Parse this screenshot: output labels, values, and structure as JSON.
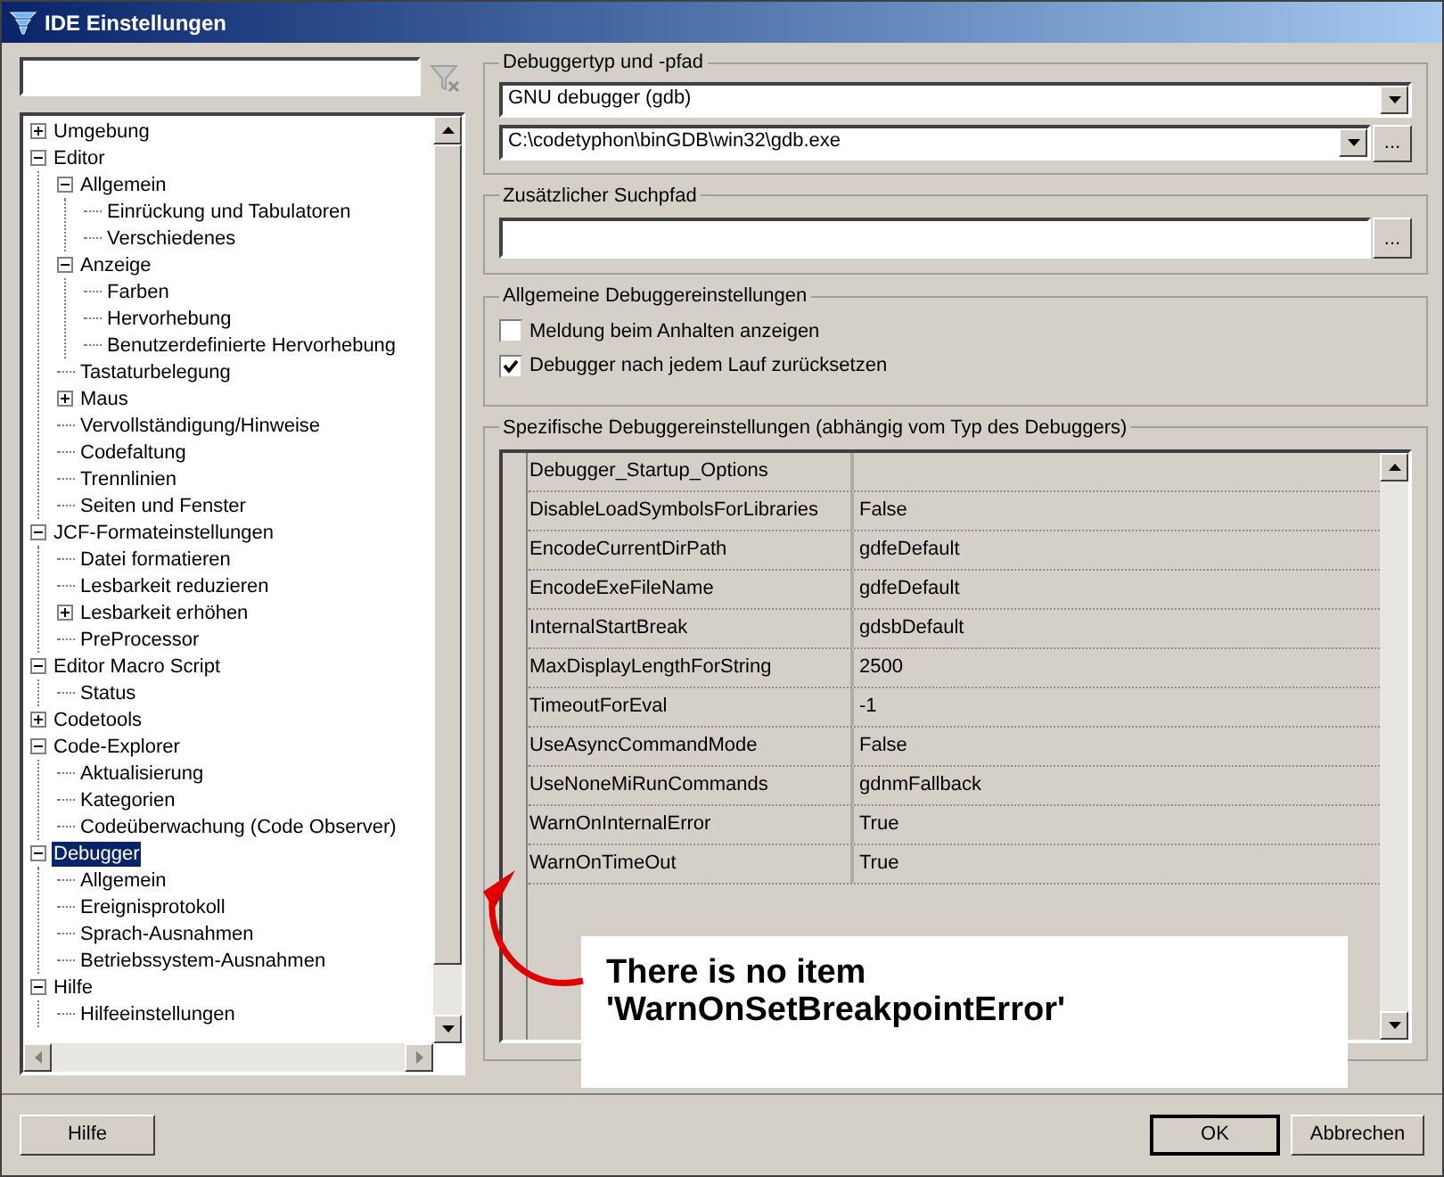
{
  "window": {
    "title": "IDE Einstellungen"
  },
  "tree": [
    {
      "label": "Umgebung",
      "expanded": false,
      "selected": false
    },
    {
      "label": "Editor",
      "expanded": true,
      "selected": false,
      "children": [
        {
          "label": "Allgemein",
          "expanded": true,
          "selected": false,
          "children": [
            {
              "label": "Einrückung und Tabulatoren",
              "selected": false
            },
            {
              "label": "Verschiedenes",
              "selected": false
            }
          ]
        },
        {
          "label": "Anzeige",
          "expanded": true,
          "selected": false,
          "children": [
            {
              "label": "Farben",
              "selected": false
            },
            {
              "label": "Hervorhebung",
              "selected": false
            },
            {
              "label": "Benutzerdefinierte Hervorhebung",
              "selected": false
            }
          ]
        },
        {
          "label": "Tastaturbelegung",
          "selected": false
        },
        {
          "label": "Maus",
          "expanded": false,
          "selected": false
        },
        {
          "label": "Vervollständigung/Hinweise",
          "selected": false
        },
        {
          "label": "Codefaltung",
          "selected": false
        },
        {
          "label": "Trennlinien",
          "selected": false
        },
        {
          "label": "Seiten und Fenster",
          "selected": false
        }
      ]
    },
    {
      "label": "JCF-Formateinstellungen",
      "expanded": true,
      "selected": false,
      "children": [
        {
          "label": "Datei formatieren",
          "selected": false
        },
        {
          "label": "Lesbarkeit reduzieren",
          "selected": false
        },
        {
          "label": "Lesbarkeit erhöhen",
          "expanded": false,
          "selected": false
        },
        {
          "label": "PreProcessor",
          "selected": false
        }
      ]
    },
    {
      "label": "Editor Macro Script",
      "expanded": true,
      "selected": false,
      "children": [
        {
          "label": "Status",
          "selected": false
        }
      ]
    },
    {
      "label": "Codetools",
      "expanded": false,
      "selected": false
    },
    {
      "label": "Code-Explorer",
      "expanded": true,
      "selected": false,
      "children": [
        {
          "label": "Aktualisierung",
          "selected": false
        },
        {
          "label": "Kategorien",
          "selected": false
        },
        {
          "label": "Codeüberwachung (Code Observer)",
          "selected": false
        }
      ]
    },
    {
      "label": "Debugger",
      "expanded": true,
      "selected": true,
      "children": [
        {
          "label": "Allgemein",
          "selected": false
        },
        {
          "label": "Ereignisprotokoll",
          "selected": false
        },
        {
          "label": "Sprach-Ausnahmen",
          "selected": false
        },
        {
          "label": "Betriebssystem-Ausnahmen",
          "selected": false
        }
      ]
    },
    {
      "label": "Hilfe",
      "expanded": true,
      "selected": false,
      "children": [
        {
          "label": "Hilfeeinstellungen",
          "selected": false
        }
      ]
    }
  ],
  "debugger_group": {
    "title": "Debuggertyp und -pfad",
    "type_value": "GNU debugger (gdb)",
    "path_value": "C:\\codetyphon\\binGDB\\win32\\gdb.exe",
    "browse": "..."
  },
  "search_path_group": {
    "title": "Zusätzlicher Suchpfad",
    "browse": "..."
  },
  "general_group": {
    "title": "Allgemeine Debuggereinstellungen",
    "options": [
      {
        "label": "Meldung beim Anhalten anzeigen",
        "checked": false
      },
      {
        "label": "Debugger nach jedem Lauf zurücksetzen",
        "checked": true
      }
    ]
  },
  "specific_group": {
    "title": "Spezifische Debuggereinstellungen (abhängig vom Typ des Debuggers)",
    "rows": [
      {
        "name": "Debugger_Startup_Options"
      },
      {
        "name": "DisableLoadSymbolsForLibraries",
        "value": "False"
      },
      {
        "name": "EncodeCurrentDirPath",
        "value": "gdfeDefault"
      },
      {
        "name": "EncodeExeFileName",
        "value": "gdfeDefault"
      },
      {
        "name": "InternalStartBreak",
        "value": "gdsbDefault"
      },
      {
        "name": "MaxDisplayLengthForString",
        "value": "2500"
      },
      {
        "name": "TimeoutForEval",
        "value": "-1"
      },
      {
        "name": "UseAsyncCommandMode",
        "value": "False"
      },
      {
        "name": "UseNoneMiRunCommands",
        "value": "gdnmFallback"
      },
      {
        "name": "WarnOnInternalError",
        "value": "True"
      },
      {
        "name": "WarnOnTimeOut",
        "value": "True"
      }
    ]
  },
  "annotation": {
    "text": "There is no item 'WarnOnSetBreakpointError'"
  },
  "buttons": {
    "help": "Hilfe",
    "ok": "OK",
    "cancel": "Abbrechen"
  }
}
